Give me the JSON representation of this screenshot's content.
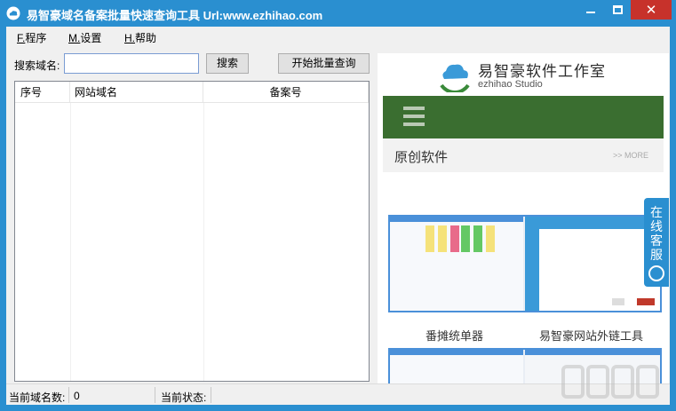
{
  "window": {
    "title": "易智豪域名备案批量快速查询工具 Url:www.ezhihao.com",
    "close_glyph": "✕"
  },
  "menu": {
    "items": [
      {
        "accel": "F.",
        "label": "程序"
      },
      {
        "accel": "M.",
        "label": "设置"
      },
      {
        "accel": "H.",
        "label": "帮助"
      }
    ]
  },
  "search": {
    "label": "搜索域名:",
    "value": "",
    "search_button": "搜索",
    "batch_button": "开始批量查询"
  },
  "table": {
    "columns": [
      "序号",
      "网站域名",
      "备案号"
    ],
    "rows": []
  },
  "ad_panel": {
    "brand": "易智豪软件工作室",
    "brand_sub": "ezhihao Studio",
    "section_title": "原创软件",
    "section_more": ">> MORE",
    "captions": [
      "番摊统单器",
      "易智豪网站外链工具"
    ],
    "chat_tab": [
      "在",
      "线",
      "客",
      "服"
    ]
  },
  "status": {
    "count_label": "当前域名数:",
    "count_value": "0",
    "state_label": "当前状态:",
    "state_value": ""
  },
  "colors": {
    "titlebar": "#2a8fd0",
    "close_button": "#c7322b",
    "nav_green": "#3a6e30"
  }
}
